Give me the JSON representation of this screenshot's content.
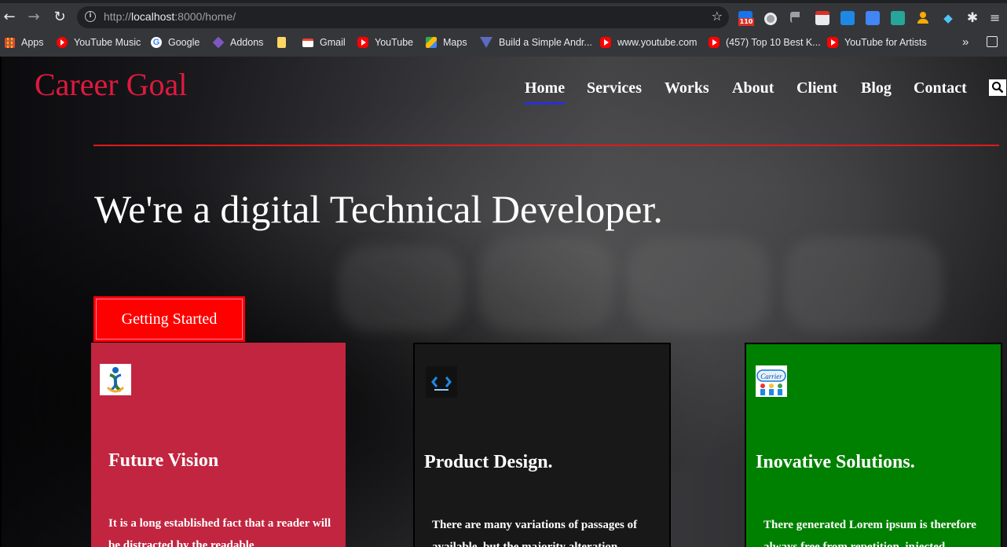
{
  "browser": {
    "url_prefix": "http://",
    "url_host": "localhost",
    "url_rest": ":8000/home/",
    "extension_badge": "110",
    "bookmarks": [
      {
        "label": "Apps",
        "icon": "apps-grid-icon"
      },
      {
        "label": "YouTube Music",
        "icon": "youtube-music-icon"
      },
      {
        "label": "Google",
        "icon": "google-icon"
      },
      {
        "label": "Addons",
        "icon": "addons-icon"
      },
      {
        "label": "",
        "icon": "folder-icon"
      },
      {
        "label": "Gmail",
        "icon": "gmail-icon"
      },
      {
        "label": "YouTube",
        "icon": "youtube-icon"
      },
      {
        "label": "Maps",
        "icon": "maps-icon"
      },
      {
        "label": "Build a Simple Andr...",
        "icon": "android-triangle-icon"
      },
      {
        "label": "www.youtube.com",
        "icon": "youtube-icon"
      },
      {
        "label": "(457) Top 10 Best K...",
        "icon": "youtube-icon"
      },
      {
        "label": "YouTube for Artists",
        "icon": "youtube-icon"
      }
    ],
    "overflow_label": "»"
  },
  "site": {
    "brand": "Career Goal",
    "nav": [
      "Home",
      "Services",
      "Works",
      "About",
      "Client",
      "Blog",
      "Contact"
    ],
    "active_nav": "Home",
    "hero_title": "We're a digital Technical Developer.",
    "cta_label": "Getting Started",
    "cards": [
      {
        "title": "Future Vision",
        "text": "It is a long established fact that a reader will be distracted by the readable",
        "color": "#c1253f"
      },
      {
        "title": "Product Design.",
        "text": "There are many variations of passages of available, but the majority alteration",
        "color": "#181818"
      },
      {
        "title": "Inovative Solutions.",
        "text": "There generated Lorem ipsum is therefore always free from repetition, injected",
        "color": "#008000"
      }
    ],
    "card3_logo_text": "Carrier"
  },
  "colors": {
    "brand": "#e0193f",
    "accent_rule": "#e01a1a",
    "cta": "#ff0000",
    "active_underline": "#2b2fd6"
  }
}
